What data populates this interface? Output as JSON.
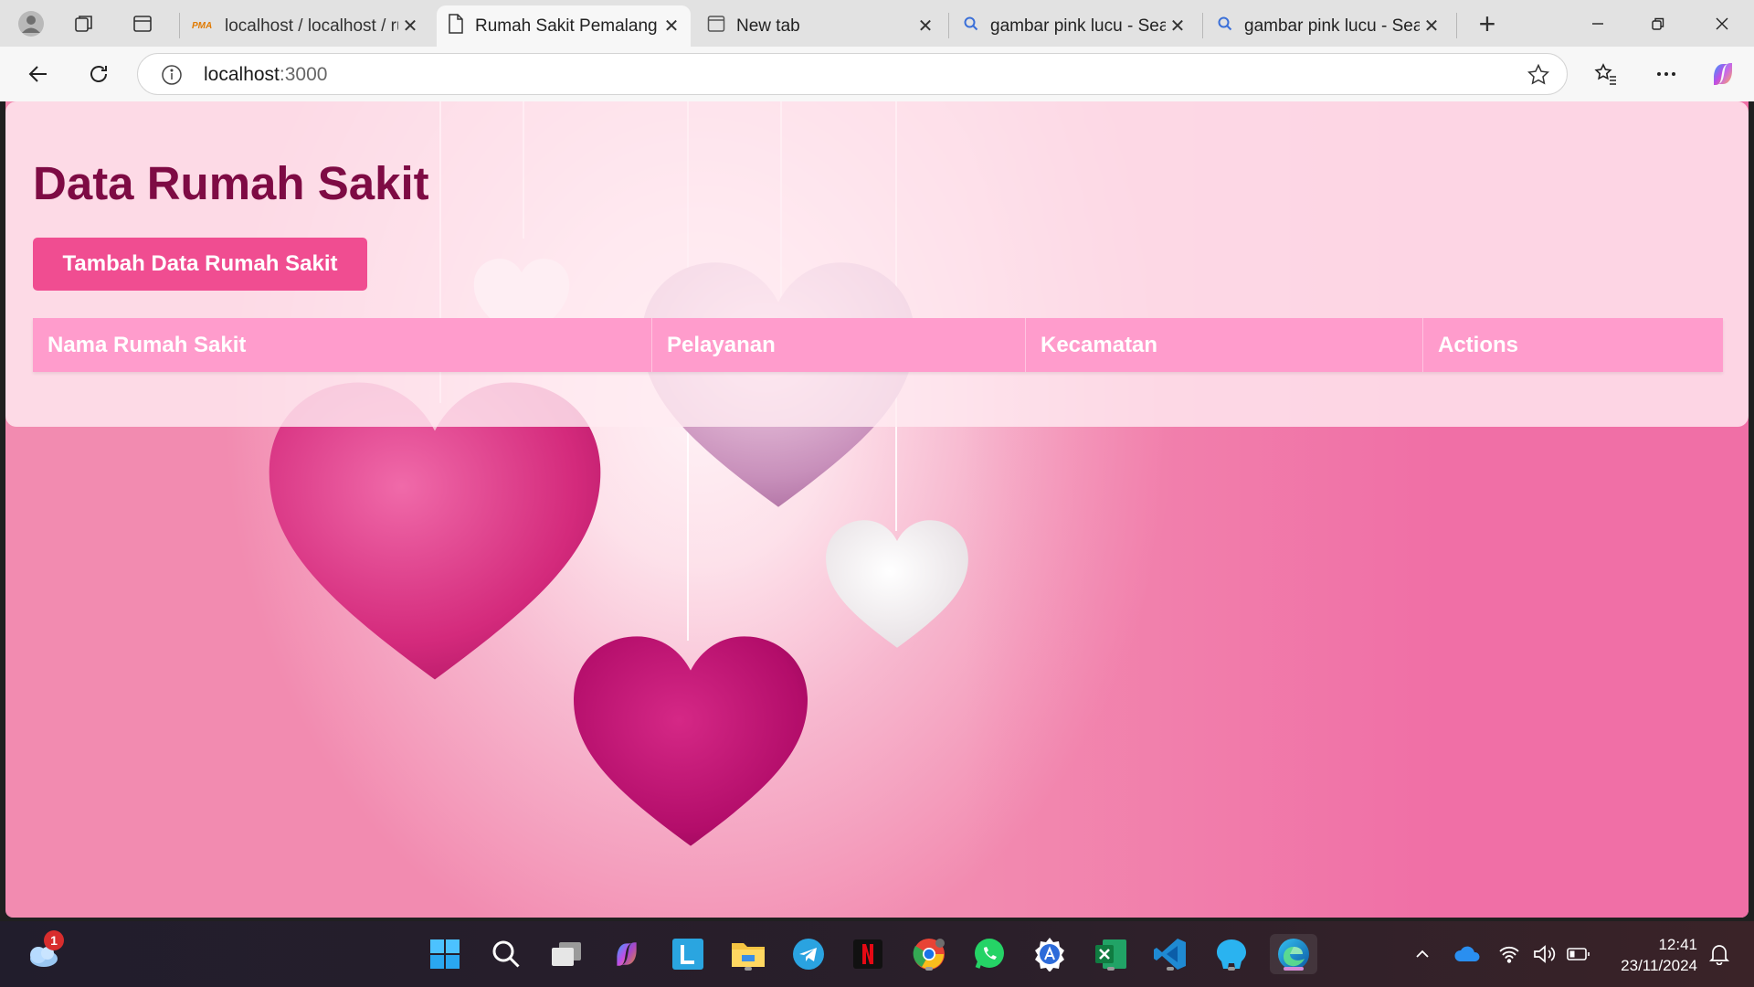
{
  "browser": {
    "tabs": [
      {
        "title": "localhost / localhost / ru",
        "icon": "pma-icon",
        "active": false
      },
      {
        "title": "Rumah Sakit Pemalang",
        "icon": "page-icon",
        "active": true
      },
      {
        "title": "New tab",
        "icon": "newtab-icon",
        "active": false
      },
      {
        "title": "gambar pink lucu - Sear",
        "icon": "search-icon",
        "active": false
      },
      {
        "title": "gambar pink lucu - Sear",
        "icon": "search-icon",
        "active": false
      }
    ],
    "close_glyph": "✕",
    "new_tab_glyph": "+",
    "address": {
      "host": "localhost",
      "port": ":3000"
    }
  },
  "page": {
    "title": "Data Rumah Sakit",
    "add_button_label": "Tambah Data Rumah Sakit",
    "table": {
      "columns": [
        "Nama Rumah Sakit",
        "Pelayanan",
        "Kecamatan",
        "Actions"
      ],
      "rows": []
    },
    "colors": {
      "title": "#7e0b44",
      "button": "#f04d91",
      "table_header": "#ff9ccc"
    }
  },
  "taskbar": {
    "weather_badge": "1",
    "apps": [
      "windows-start-icon",
      "search-icon",
      "task-view-icon",
      "copilot-icon",
      "l-app-icon",
      "file-explorer-icon",
      "telegram-icon",
      "netflix-icon",
      "chrome-icon",
      "whatsapp-icon",
      "pen-app-icon",
      "excel-icon",
      "vscode-icon",
      "blue-app-icon",
      "edge-icon"
    ],
    "clock": {
      "time": "12:41",
      "date": "23/11/2024"
    }
  }
}
